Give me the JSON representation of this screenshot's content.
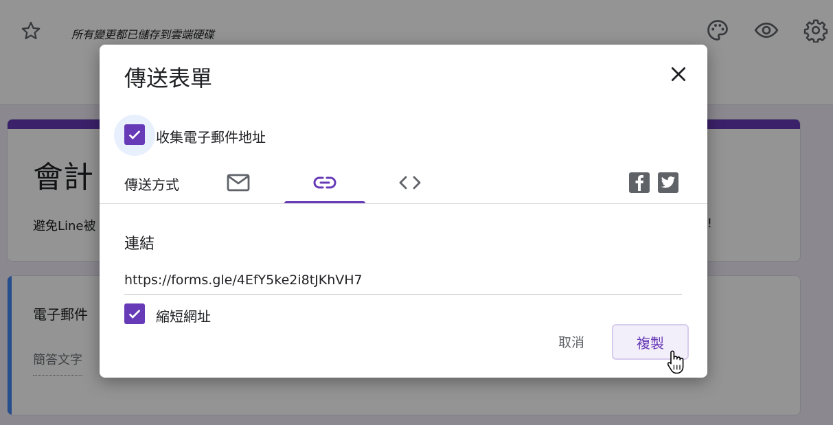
{
  "app": {
    "save_status": "所有變更都已儲存到雲端硬碟",
    "icons": [
      "star-icon",
      "palette-icon",
      "eye-icon",
      "gear-icon"
    ]
  },
  "form": {
    "title_partial": "會計",
    "description_partial": "避免Line被",
    "description_tail": "!",
    "question_title_partial": "電子郵件",
    "answer_placeholder": "簡答文字"
  },
  "dialog": {
    "title": "傳送表單",
    "collect_email_label": "收集電子郵件地址",
    "collect_email_checked": true,
    "send_via_label": "傳送方式",
    "tabs": [
      {
        "name": "email",
        "icon": "mail-icon",
        "active": false
      },
      {
        "name": "link",
        "icon": "link-icon",
        "active": true
      },
      {
        "name": "embed",
        "icon": "code-icon",
        "active": false
      }
    ],
    "share_icons": [
      "facebook-icon",
      "twitter-icon"
    ],
    "section_label": "連結",
    "link_url": "https://forms.gle/4EfY5ke2i8tJKhVH7",
    "shorten_label": "縮短網址",
    "shorten_checked": true,
    "cancel_label": "取消",
    "copy_label": "複製"
  },
  "colors": {
    "accent": "#673ab7",
    "question_bar": "#4285f4",
    "icon_grey": "#5f6368"
  }
}
